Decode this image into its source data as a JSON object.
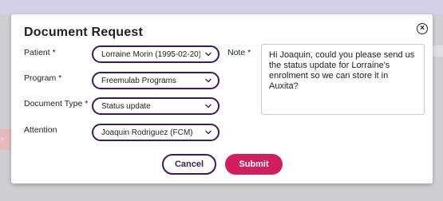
{
  "dialog": {
    "title": "Document Request",
    "close_label": "×"
  },
  "fields": {
    "patient": {
      "label": "Patient *",
      "value": "Lorraine Morin (1995-02-20)"
    },
    "program": {
      "label": "Program *",
      "value": "Freemulab Programs"
    },
    "document_type": {
      "label": "Document Type *",
      "value": "Status update"
    },
    "attention": {
      "label": "Attention",
      "value": "Joaquin Rodriguez (FCM)"
    }
  },
  "note": {
    "label": "Note *",
    "value": "Hi Joaquin, could you please send us the status update for Lorraine's enrolment so we can store it in Auxita?"
  },
  "buttons": {
    "cancel": "Cancel",
    "submit": "Submit"
  },
  "colors": {
    "accent": "#3b1e54",
    "submit": "#cf1f5e"
  }
}
